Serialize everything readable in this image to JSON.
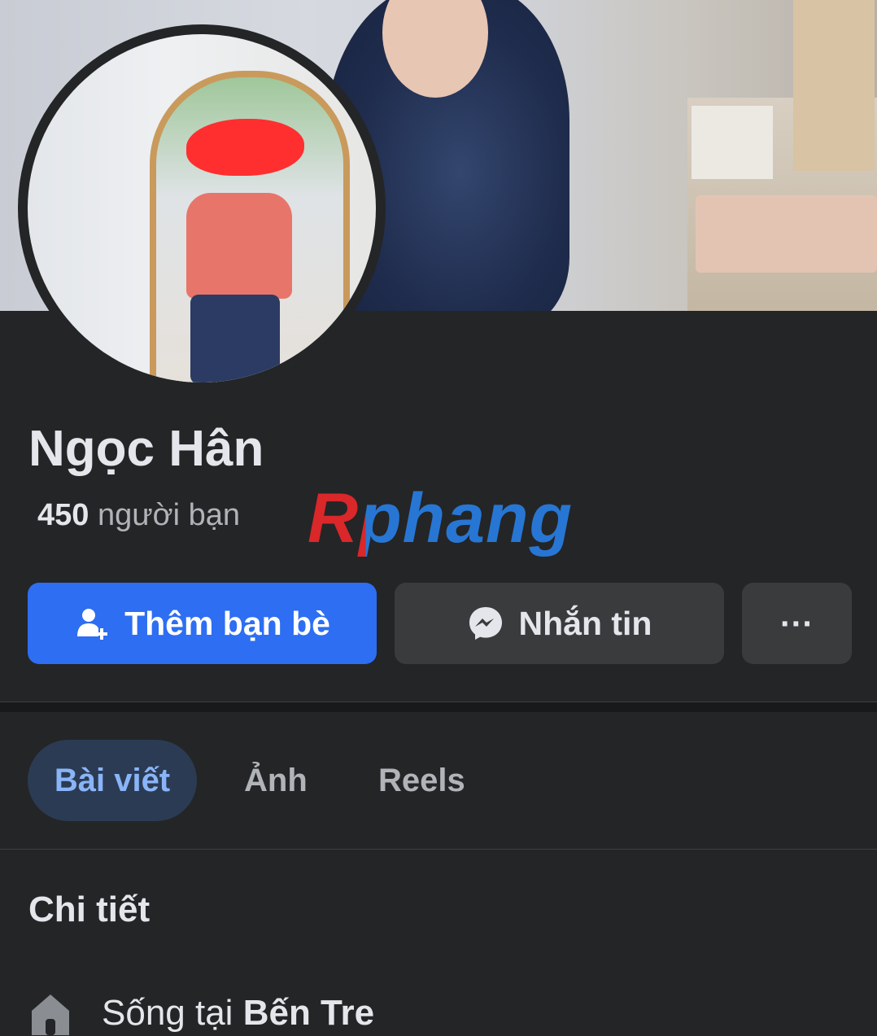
{
  "profile": {
    "name": "Ngọc Hân",
    "friends_count": "450",
    "friends_label": "người bạn"
  },
  "watermark": {
    "text": "Rphang"
  },
  "actions": {
    "add_friend_label": "Thêm bạn bè",
    "message_label": "Nhắn tin",
    "more_label": "···"
  },
  "tabs": [
    {
      "label": "Bài viết",
      "active": true
    },
    {
      "label": "Ảnh",
      "active": false
    },
    {
      "label": "Reels",
      "active": false
    }
  ],
  "details": {
    "title": "Chi tiết",
    "lives_in_prefix": "Sống tại",
    "lives_in_place": "Bến Tre"
  },
  "icons": {
    "add_friend": "add-person-icon",
    "message": "messenger-icon",
    "location": "home-icon"
  },
  "colors": {
    "primary_button": "#2d6ef2",
    "background": "#242526",
    "active_tab_text": "#8ab4f8"
  }
}
